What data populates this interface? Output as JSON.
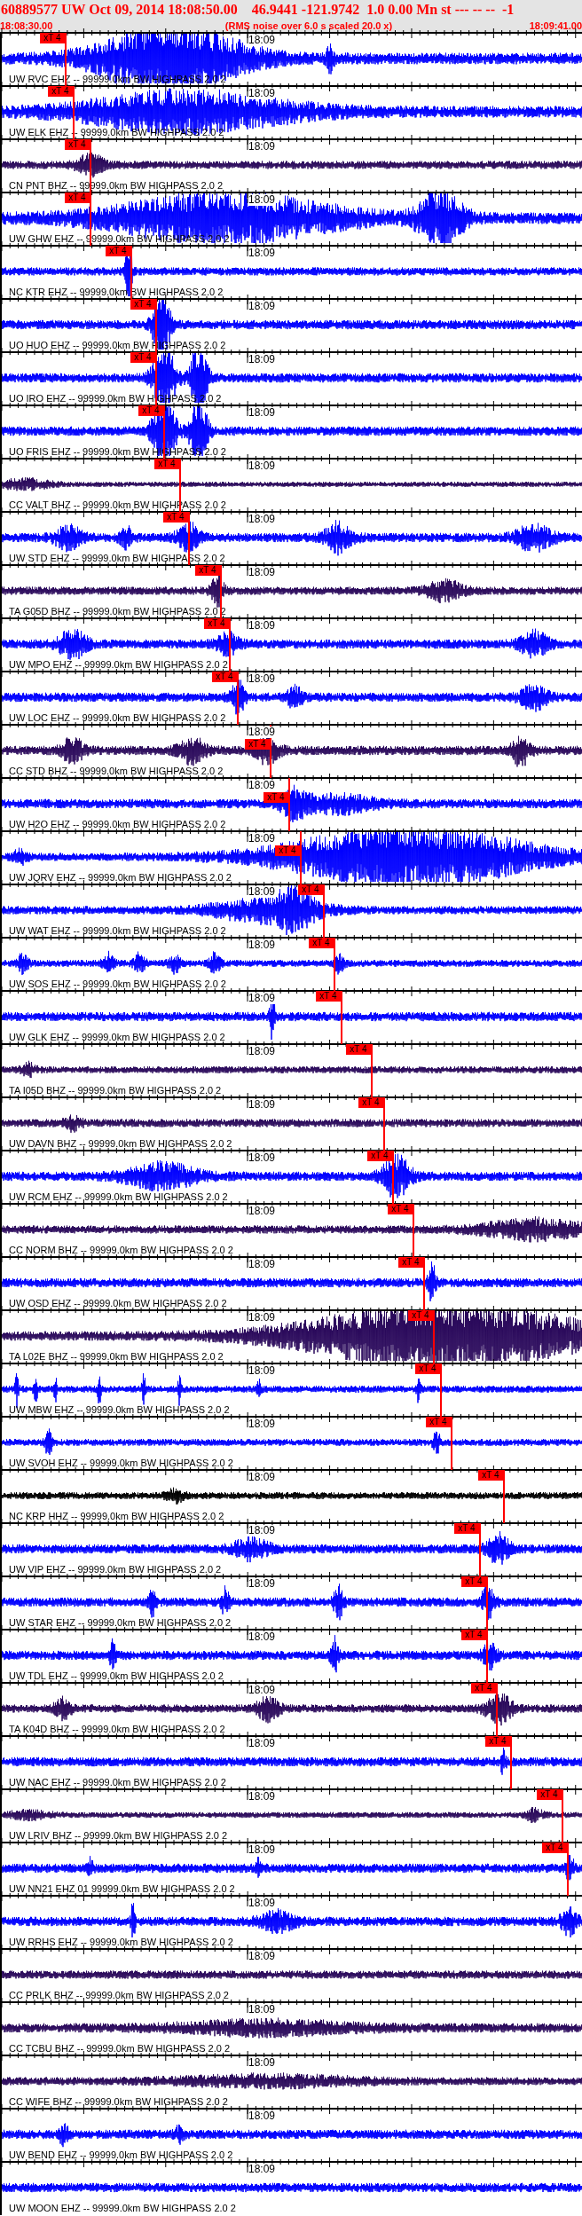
{
  "header": {
    "title": "60889577 UW Oct 09, 2014 18:08:50.00    46.9441 -121.9742  1.0 0.00 Mn st --- -- --  -1",
    "start_time": "18:08:30.00",
    "note": "(RMS noise over 6.0 s scaled 20.0 x)",
    "end_time": "18:09:41.00"
  },
  "traces": [
    {
      "label": "UW RVC EHZ -- 99999.0km BW HIGHPASS 2.0 2",
      "time": "18:09",
      "color": "#0000ff",
      "pick": "xT 4"
    },
    {
      "label": "UW ELK EHZ -- 99999.0km BW HIGHPASS 2.0 2",
      "time": "18:09",
      "color": "#0000ff",
      "pick": "xT 4"
    },
    {
      "label": "CN PNT BHZ -- 99999.0km BW HIGHPASS 2.0 2",
      "time": "18:09",
      "color": "#2b0a5c",
      "pick": "xT 4"
    },
    {
      "label": "UW GHW EHZ -- 99999.0km BW HIGHPASS 2.0 2",
      "time": "18:09",
      "color": "#0000ff",
      "pick": "xT 4"
    },
    {
      "label": "NC KTR EHZ -- 99999.0km BW HIGHPASS 2.0 2",
      "time": "18:09",
      "color": "#0000ff",
      "pick": "xT 4"
    },
    {
      "label": "UO HUO EHZ -- 99999.0km BW HIGHPASS 2.0 2",
      "time": "18:09",
      "color": "#0000ff",
      "pick": "xT 4"
    },
    {
      "label": "UO IRO EHZ -- 99999.0km BW HIGHPASS 2.0 2",
      "time": "18:09",
      "color": "#0000ff",
      "pick": "xT 4"
    },
    {
      "label": "UO FRIS EHZ -- 99999.0km BW HIGHPASS 2.0 2",
      "time": "18:09",
      "color": "#0000ff",
      "pick": "xT 4"
    },
    {
      "label": "CC VALT BHZ -- 99999.0km BW HIGHPASS 2.0 2",
      "time": "18:09",
      "color": "#2b0a5c",
      "pick": "xT 4"
    },
    {
      "label": "UW STD EHZ -- 99999.0km BW HIGHPASS 2.0 2",
      "time": "18:09",
      "color": "#0000ff",
      "pick": "xT 4"
    },
    {
      "label": "TA G05D BHZ -- 99999.0km BW HIGHPASS 2.0 2",
      "time": "18:09",
      "color": "#2b0a5c",
      "pick": "xT 4"
    },
    {
      "label": "UW MPO EHZ -- 99999.0km BW HIGHPASS 2.0 2",
      "time": "18:09",
      "color": "#0000ff",
      "pick": "xT 4"
    },
    {
      "label": "UW LOC EHZ -- 99999.0km BW HIGHPASS 2.0 2",
      "time": "18:09",
      "color": "#0000ff",
      "pick": "xT 4"
    },
    {
      "label": "CC STD BHZ -- 99999.0km BW HIGHPASS 2.0 2",
      "time": "18:09",
      "color": "#2b0a5c",
      "pick": "xT 4"
    },
    {
      "label": "UW H2O EHZ -- 99999.0km BW HIGHPASS 2.0 2",
      "time": "18:09",
      "color": "#0000ff",
      "pick": "xT 4"
    },
    {
      "label": "UW JQRV EHZ -- 99999.0km BW HIGHPASS 2.0 2",
      "time": "18:09",
      "color": "#0000ff",
      "pick": "xT 4"
    },
    {
      "label": "UW WAT EHZ -- 99999.0km BW HIGHPASS 2.0 2",
      "time": "18:09",
      "color": "#0000ff",
      "pick": "xT 4"
    },
    {
      "label": "UW SOS EHZ -- 99999.0km BW HIGHPASS 2.0 2",
      "time": "18:09",
      "color": "#0000ff",
      "pick": "xT 4"
    },
    {
      "label": "UW GLK EHZ -- 99999.0km BW HIGHPASS 2.0 2",
      "time": "18:09",
      "color": "#0000ff",
      "pick": "xT 4"
    },
    {
      "label": "TA I05D BHZ -- 99999.0km BW HIGHPASS 2.0 2",
      "time": "18:09",
      "color": "#2b0a5c",
      "pick": "xT 4"
    },
    {
      "label": "UW DAVN BHZ -- 99999.0km BW HIGHPASS 2.0 2",
      "time": "18:09",
      "color": "#2b0a5c",
      "pick": "xT 4"
    },
    {
      "label": "UW RCM EHZ -- 99999.0km BW HIGHPASS 2.0 2",
      "time": "18:09",
      "color": "#0000ff",
      "pick": "xT 4"
    },
    {
      "label": "CC NORM BHZ -- 99999.0km BW HIGHPASS 2.0 2",
      "time": "18:09",
      "color": "#2b0a5c",
      "pick": "xT 4"
    },
    {
      "label": "UW OSD EHZ -- 99999.0km BW HIGHPASS 2.0 2",
      "time": "18:09",
      "color": "#0000ff",
      "pick": "xT 4"
    },
    {
      "label": "TA L02E BHZ -- 99999.0km BW HIGHPASS 2.0 2",
      "time": "18:09",
      "color": "#2b0a5c",
      "pick": "xT 4"
    },
    {
      "label": "UW MBW EHZ -- 99999.0km BW HIGHPASS 2.0 2",
      "time": "18:09",
      "color": "#0000ff",
      "pick": "xT 4"
    },
    {
      "label": "UW SVOH EHZ -- 99999.0km BW HIGHPASS 2.0 2",
      "time": "18:09",
      "color": "#0000ff",
      "pick": "xT 4"
    },
    {
      "label": "NC KRP HHZ -- 99999.0km BW HIGHPASS 2.0 2",
      "time": "18:09",
      "color": "#000000",
      "pick": "xT 4"
    },
    {
      "label": "UW VIP EHZ -- 99999.0km BW HIGHPASS 2.0 2",
      "time": "18:09",
      "color": "#0000ff",
      "pick": "xT 4"
    },
    {
      "label": "UW STAR EHZ -- 99999.0km BW HIGHPASS 2.0 2",
      "time": "18:09",
      "color": "#0000ff",
      "pick": "xT 4"
    },
    {
      "label": "UW TDL EHZ -- 99999.0km BW HIGHPASS 2.0 2",
      "time": "18:09",
      "color": "#0000ff",
      "pick": "xT 4"
    },
    {
      "label": "TA K04D BHZ -- 99999.0km BW HIGHPASS 2.0 2",
      "time": "18:09",
      "color": "#2b0a5c",
      "pick": "xT 4"
    },
    {
      "label": "UW NAC EHZ -- 99999.0km BW HIGHPASS 2.0 2",
      "time": "18:09",
      "color": "#0000ff",
      "pick": "xT 4"
    },
    {
      "label": "UW LRIV BHZ -- 99999.0km BW HIGHPASS 2.0 2",
      "time": "18:09",
      "color": "#2b0a5c",
      "pick": "xT 4"
    },
    {
      "label": "UW NN21 EHZ 01 99999.0km BW HIGHPASS 2.0 2",
      "time": "18:09",
      "color": "#0000ff",
      "pick": "xT 4"
    },
    {
      "label": "UW RRHS EHZ -- 99999.0km BW HIGHPASS 2.0 2",
      "time": "18:09",
      "color": "#0000ff"
    },
    {
      "label": "CC PRLK BHZ -- 99999.0km BW HIGHPASS 2.0 2",
      "time": "18:09",
      "color": "#2b0a5c"
    },
    {
      "label": "CC TCBU BHZ -- 99999.0km BW HIGHPASS 2.0 2",
      "time": "18:09",
      "color": "#2b0a5c"
    },
    {
      "label": "CC WIFE BHZ -- 99999.0km BW HIGHPASS 2.0 2",
      "time": "18:09",
      "color": "#2b0a5c"
    },
    {
      "label": "UW BEND EHZ -- 99999.0km BW HIGHPASS 2.0 2",
      "time": "18:09",
      "color": "#0000ff"
    },
    {
      "label": "UW MOON EHZ -- 99999.0km BW HIGHPASS 2.0 2",
      "time": "18:09",
      "color": "#0000ff"
    }
  ]
}
